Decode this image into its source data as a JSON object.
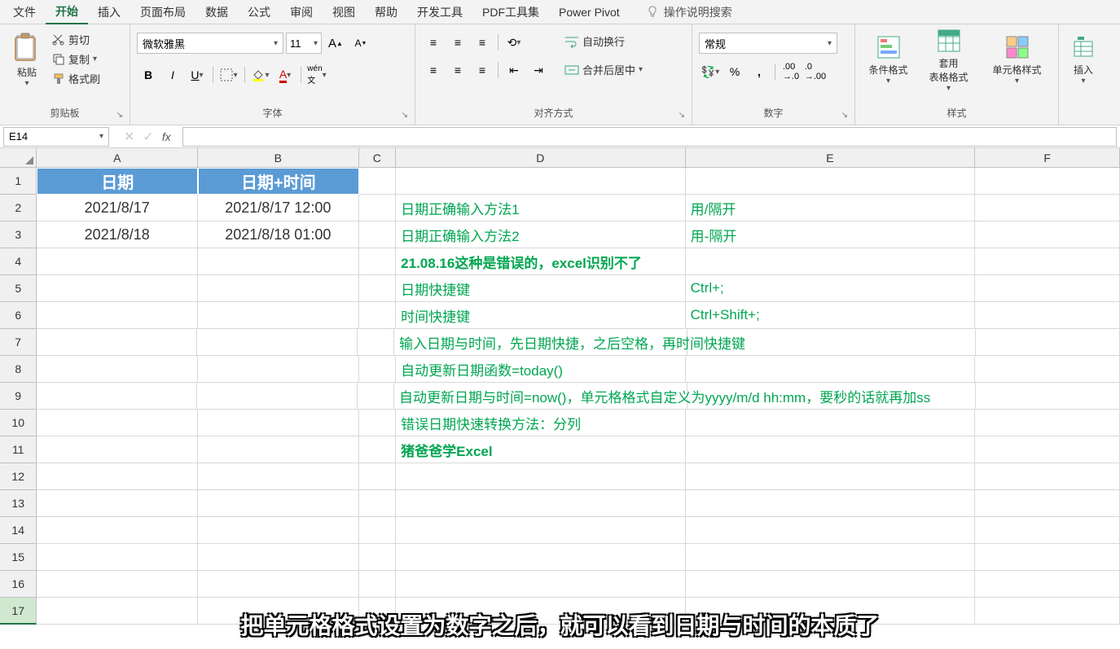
{
  "menu": {
    "items": [
      "文件",
      "开始",
      "插入",
      "页面布局",
      "数据",
      "公式",
      "审阅",
      "视图",
      "帮助",
      "开发工具",
      "PDF工具集",
      "Power Pivot"
    ],
    "active": 1,
    "tell_me": "操作说明搜索"
  },
  "ribbon": {
    "clipboard": {
      "paste": "粘贴",
      "cut": "剪切",
      "copy": "复制",
      "format_painter": "格式刷",
      "label": "剪贴板"
    },
    "font": {
      "name": "微软雅黑",
      "size": "11",
      "label": "字体"
    },
    "align": {
      "wrap": "自动换行",
      "merge": "合并后居中",
      "label": "对齐方式"
    },
    "number": {
      "format": "常规",
      "label": "数字"
    },
    "styles": {
      "cond": "条件格式",
      "table": "套用\n表格格式",
      "cell": "单元格样式",
      "label": "样式"
    },
    "cells": {
      "insert": "插入"
    }
  },
  "namebox": "E14",
  "cols": {
    "A": 200,
    "B": 200,
    "C": 46,
    "D": 360,
    "E": 360,
    "F": 180
  },
  "grid": {
    "h": {
      "A": "日期",
      "B": "日期+时间"
    },
    "r2": {
      "A": "2021/8/17",
      "B": "2021/8/17 12:00",
      "D": "日期正确输入方法1",
      "E": "用/隔开"
    },
    "r3": {
      "A": "2021/8/18",
      "B": "2021/8/18 01:00",
      "D": "日期正确输入方法2",
      "E": "用-隔开"
    },
    "r4": {
      "D": "21.08.16这种是错误的，excel识别不了"
    },
    "r5": {
      "D": "日期快捷键",
      "E": "Ctrl+;"
    },
    "r6": {
      "D": "时间快捷键",
      "E": "Ctrl+Shift+;"
    },
    "r7": {
      "D": "输入日期与时间，先日期快捷，之后空格，再时间快捷键"
    },
    "r8": {
      "D": "自动更新日期函数=today()"
    },
    "r9": {
      "D": "自动更新日期与时间=now()，单元格格式自定义为yyyy/m/d hh:mm，要秒的话就再加ss"
    },
    "r10": {
      "D": "错误日期快速转换方法：分列"
    },
    "r11": {
      "D": "猪爸爸学Excel"
    }
  },
  "caption": "把单元格格式设置为数字之后，就可以看到日期与时间的本质了"
}
